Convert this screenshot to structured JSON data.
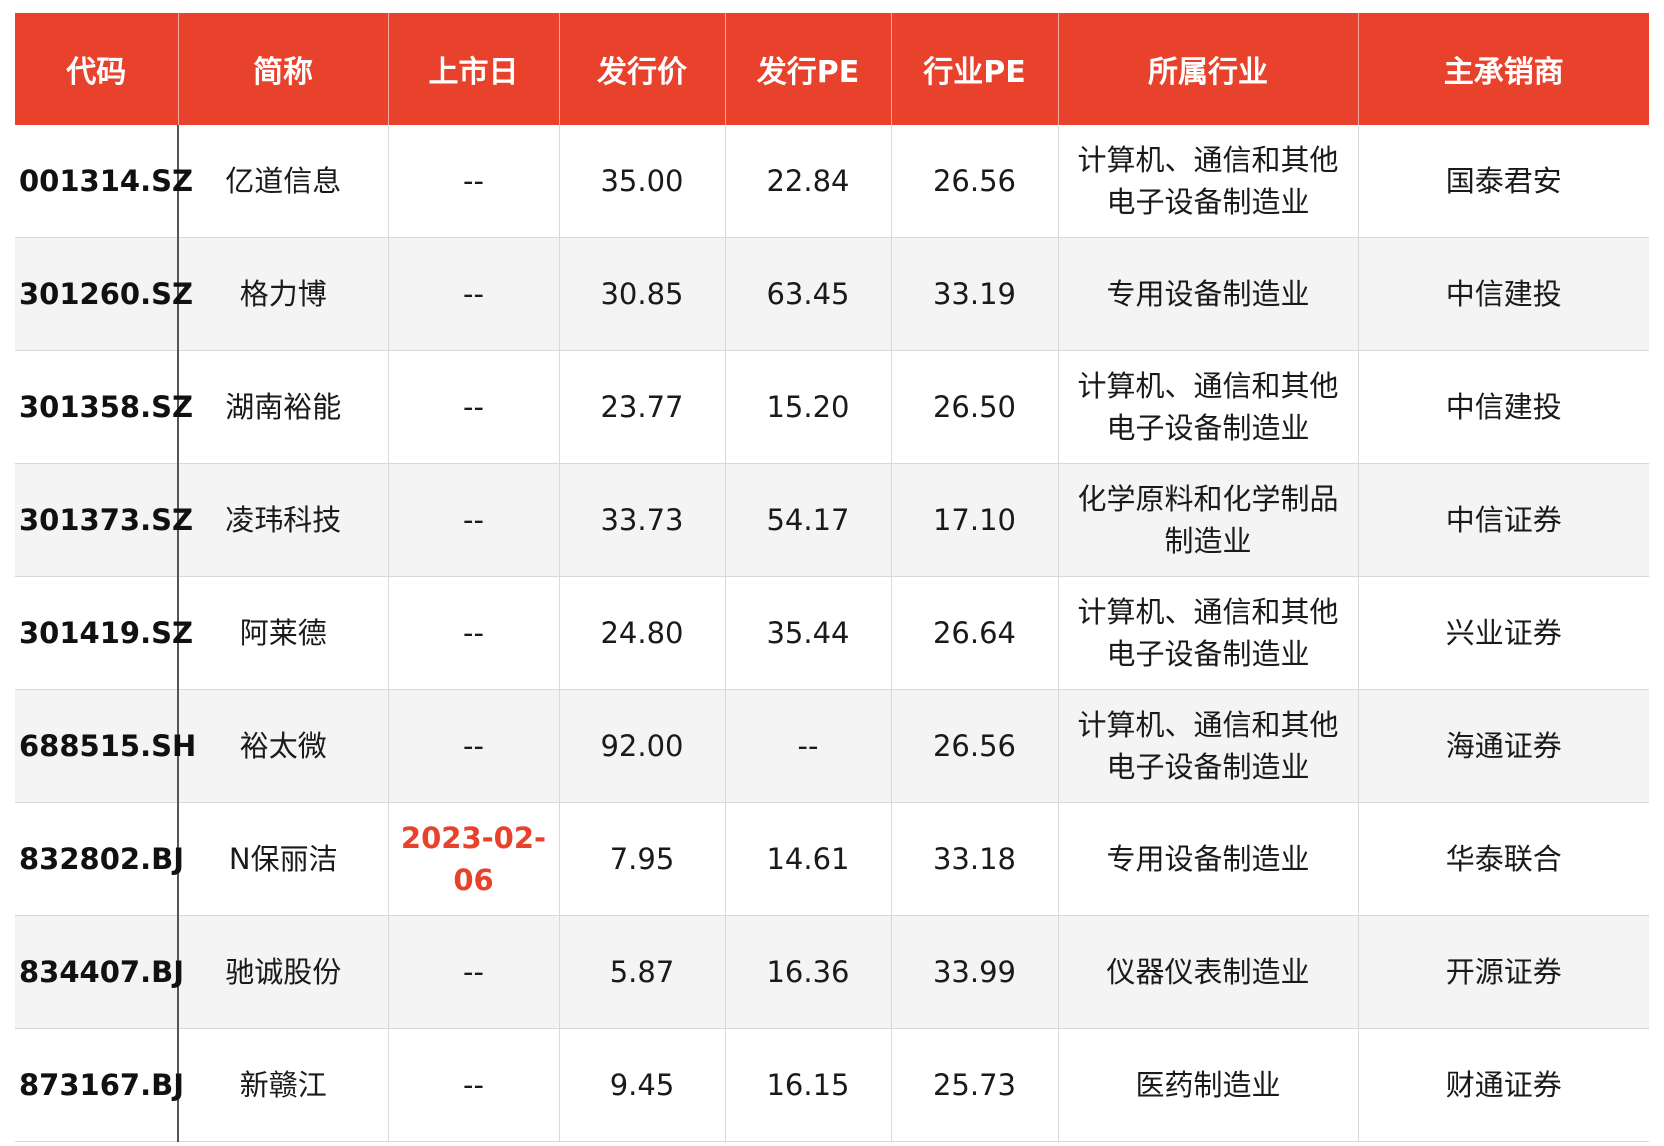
{
  "colors": {
    "header_bg": "#e8412c",
    "header_text": "#ffffff",
    "highlight_text": "#e8412c",
    "stripe_bg": "#f4f4f4"
  },
  "table": {
    "headers": [
      "代码",
      "简称",
      "上市日",
      "发行价",
      "发行PE",
      "行业PE",
      "所属行业",
      "主承销商"
    ],
    "rows": [
      [
        "001314.SZ",
        "亿道信息",
        "--",
        "35.00",
        "22.84",
        "26.56",
        "计算机、通信和其他电子设备制造业",
        "国泰君安"
      ],
      [
        "301260.SZ",
        "格力博",
        "--",
        "30.85",
        "63.45",
        "33.19",
        "专用设备制造业",
        "中信建投"
      ],
      [
        "301358.SZ",
        "湖南裕能",
        "--",
        "23.77",
        "15.20",
        "26.50",
        "计算机、通信和其他电子设备制造业",
        "中信建投"
      ],
      [
        "301373.SZ",
        "凌玮科技",
        "--",
        "33.73",
        "54.17",
        "17.10",
        "化学原料和化学制品制造业",
        "中信证券"
      ],
      [
        "301419.SZ",
        "阿莱德",
        "--",
        "24.80",
        "35.44",
        "26.64",
        "计算机、通信和其他电子设备制造业",
        "兴业证券"
      ],
      [
        "688515.SH",
        "裕太微",
        "--",
        "92.00",
        "--",
        "26.56",
        "计算机、通信和其他电子设备制造业",
        "海通证券"
      ],
      [
        "832802.BJ",
        "N保丽洁",
        "2023-02-06",
        "7.95",
        "14.61",
        "33.18",
        "专用设备制造业",
        "华泰联合"
      ],
      [
        "834407.BJ",
        "驰诚股份",
        "--",
        "5.87",
        "16.36",
        "33.99",
        "仪器仪表制造业",
        "开源证券"
      ],
      [
        "873167.BJ",
        "新赣江",
        "--",
        "9.45",
        "16.15",
        "25.73",
        "医药制造业",
        "财通证券"
      ]
    ]
  }
}
